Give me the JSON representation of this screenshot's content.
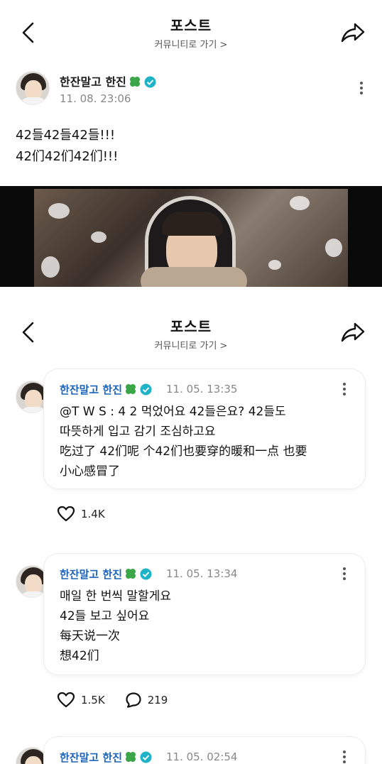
{
  "header": {
    "title": "포스트",
    "community_link": "커뮤니티로 가기 >"
  },
  "main_post": {
    "author": "한잔말고 한진",
    "timestamp": "11. 08. 23:06",
    "lines": [
      "42들42들42들!!!",
      "42们42们42们!!!"
    ],
    "media": "video-still"
  },
  "comments": [
    {
      "author": "한잔말고 한진",
      "timestamp": "11. 05. 13:35",
      "lines": [
        "@T W S : 4 2 먹었어요 42들은요? 42들도",
        "따뜻하게 입고 감기 조심하고요",
        "吃过了 42们呢 个42们也要穿的暖和一点 也要",
        "小心感冒了"
      ],
      "likes": "1.4K"
    },
    {
      "author": "한잔말고 한진",
      "timestamp": "11. 05. 13:34",
      "lines": [
        "매일 한 번씩 말할게요",
        "42들 보고 싶어요",
        "每天说一次",
        "想42们"
      ],
      "likes": "1.5K",
      "replies": "219"
    },
    {
      "author": "한잔말고 한진",
      "timestamp": "11. 05. 02:54"
    }
  ],
  "icons": {
    "back": "back-arrow-icon",
    "share": "share-icon",
    "more": "more-vertical-icon",
    "clover": "four-leaf-clover-icon",
    "verified": "verified-badge-icon",
    "like": "heart-icon",
    "reply": "comment-bubble-icon"
  },
  "colors": {
    "name_blue": "#1b63b8",
    "verified": "#1fb3c8",
    "clover": "#3aa648"
  }
}
